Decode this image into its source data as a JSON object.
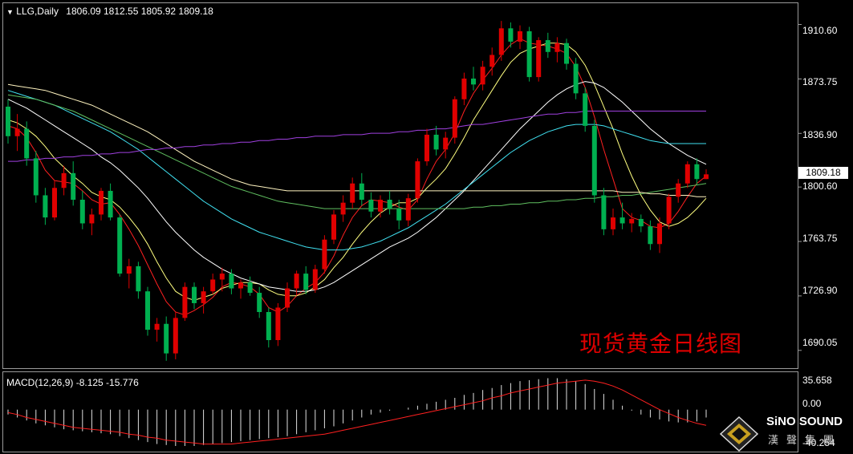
{
  "header": {
    "symbol": "LLG,Daily",
    "ohlc": "1806.09 1812.55 1805.92 1809.18"
  },
  "price_axis": {
    "labels": [
      "1910.60",
      "1873.75",
      "1836.90",
      "1800.60",
      "1763.75",
      "1726.90",
      "1690.05"
    ],
    "current_price": "1809.18"
  },
  "macd_panel": {
    "label": "MACD(12,26,9) -8.125 -15.776",
    "axis_labels": [
      "35.658",
      "0.00",
      "-40.254"
    ]
  },
  "watermark": "现货黄金日线图",
  "logo": {
    "text_en": "SiNO SOUND",
    "text_cn": "漢聲集團"
  },
  "colors": {
    "background": "#000000",
    "up_candle": "#e00000",
    "down_candle": "#00b050",
    "ma_red": "#ff2020",
    "ma_yellow": "#ffff80",
    "ma_white": "#ffffff",
    "ma_cyan": "#40e0f0",
    "ma_green": "#60c060",
    "ma_cream": "#fff4c0",
    "ma_purple": "#a040e0"
  },
  "chart_data": {
    "type": "candlestick",
    "title": "现货黄金日线图",
    "symbol": "LLG",
    "timeframe": "Daily",
    "ylim": [
      1678,
      1925
    ],
    "candles": [
      [
        1855,
        1860,
        1830,
        1835
      ],
      [
        1835,
        1850,
        1825,
        1840
      ],
      [
        1840,
        1845,
        1815,
        1820
      ],
      [
        1820,
        1825,
        1790,
        1795
      ],
      [
        1795,
        1800,
        1775,
        1780
      ],
      [
        1780,
        1805,
        1778,
        1800
      ],
      [
        1800,
        1815,
        1795,
        1810
      ],
      [
        1810,
        1818,
        1788,
        1792
      ],
      [
        1792,
        1798,
        1772,
        1776
      ],
      [
        1776,
        1786,
        1768,
        1782
      ],
      [
        1782,
        1800,
        1778,
        1798
      ],
      [
        1798,
        1803,
        1778,
        1780
      ],
      [
        1780,
        1782,
        1740,
        1742
      ],
      [
        1742,
        1752,
        1732,
        1747
      ],
      [
        1747,
        1750,
        1725,
        1730
      ],
      [
        1730,
        1733,
        1700,
        1704
      ],
      [
        1704,
        1712,
        1696,
        1708
      ],
      [
        1708,
        1713,
        1683,
        1688
      ],
      [
        1688,
        1716,
        1684,
        1712
      ],
      [
        1712,
        1736,
        1710,
        1733
      ],
      [
        1733,
        1736,
        1718,
        1722
      ],
      [
        1722,
        1733,
        1715,
        1730
      ],
      [
        1730,
        1742,
        1728,
        1738
      ],
      [
        1738,
        1746,
        1730,
        1742
      ],
      [
        1742,
        1745,
        1728,
        1732
      ],
      [
        1732,
        1738,
        1725,
        1736
      ],
      [
        1736,
        1740,
        1727,
        1729
      ],
      [
        1729,
        1733,
        1712,
        1716
      ],
      [
        1716,
        1719,
        1692,
        1697
      ],
      [
        1697,
        1722,
        1693,
        1719
      ],
      [
        1719,
        1736,
        1716,
        1732
      ],
      [
        1732,
        1744,
        1727,
        1742
      ],
      [
        1742,
        1747,
        1728,
        1731
      ],
      [
        1731,
        1748,
        1729,
        1745
      ],
      [
        1745,
        1768,
        1742,
        1765
      ],
      [
        1765,
        1785,
        1762,
        1782
      ],
      [
        1782,
        1795,
        1777,
        1790
      ],
      [
        1790,
        1807,
        1786,
        1803
      ],
      [
        1803,
        1810,
        1788,
        1792
      ],
      [
        1792,
        1797,
        1780,
        1784
      ],
      [
        1784,
        1795,
        1780,
        1792
      ],
      [
        1792,
        1798,
        1782,
        1786
      ],
      [
        1786,
        1792,
        1772,
        1778
      ],
      [
        1778,
        1796,
        1774,
        1793
      ],
      [
        1793,
        1820,
        1790,
        1818
      ],
      [
        1818,
        1840,
        1815,
        1836
      ],
      [
        1836,
        1842,
        1822,
        1826
      ],
      [
        1826,
        1838,
        1820,
        1834
      ],
      [
        1834,
        1862,
        1830,
        1860
      ],
      [
        1860,
        1878,
        1856,
        1874
      ],
      [
        1874,
        1882,
        1866,
        1870
      ],
      [
        1870,
        1886,
        1866,
        1882
      ],
      [
        1882,
        1895,
        1876,
        1890
      ],
      [
        1890,
        1913,
        1886,
        1908
      ],
      [
        1908,
        1912,
        1895,
        1899
      ],
      [
        1899,
        1910,
        1894,
        1906
      ],
      [
        1906,
        1909,
        1872,
        1875
      ],
      [
        1875,
        1902,
        1872,
        1900
      ],
      [
        1900,
        1905,
        1888,
        1892
      ],
      [
        1892,
        1902,
        1885,
        1898
      ],
      [
        1898,
        1901,
        1880,
        1884
      ],
      [
        1884,
        1888,
        1860,
        1864
      ],
      [
        1864,
        1868,
        1838,
        1842
      ],
      [
        1842,
        1846,
        1790,
        1795
      ],
      [
        1795,
        1800,
        1768,
        1772
      ],
      [
        1772,
        1786,
        1768,
        1780
      ],
      [
        1780,
        1790,
        1772,
        1776
      ],
      [
        1776,
        1783,
        1770,
        1779
      ],
      [
        1779,
        1782,
        1770,
        1774
      ],
      [
        1774,
        1778,
        1758,
        1762
      ],
      [
        1762,
        1780,
        1756,
        1776
      ],
      [
        1776,
        1796,
        1772,
        1794
      ],
      [
        1794,
        1806,
        1790,
        1803
      ],
      [
        1803,
        1818,
        1800,
        1816
      ],
      [
        1816,
        1820,
        1802,
        1806
      ],
      [
        1806,
        1812.55,
        1805.92,
        1809.18
      ]
    ],
    "moving_averages": [
      {
        "color": "#ff2020",
        "values": [
          1842,
          1840,
          1834,
          1824,
          1812,
          1805,
          1804,
          1803,
          1798,
          1792,
          1789,
          1790,
          1782,
          1772,
          1761,
          1748,
          1735,
          1723,
          1716,
          1714,
          1717,
          1721,
          1726,
          1733,
          1736,
          1735,
          1733,
          1728,
          1719,
          1716,
          1720,
          1727,
          1732,
          1736,
          1743,
          1754,
          1768,
          1780,
          1788,
          1792,
          1791,
          1790,
          1787,
          1785,
          1792,
          1806,
          1818,
          1826,
          1837,
          1852,
          1864,
          1873,
          1881,
          1890,
          1897,
          1901,
          1898,
          1897,
          1896,
          1894,
          1891,
          1882,
          1868,
          1848,
          1826,
          1806,
          1786,
          1780,
          1778,
          1774,
          1773,
          1776,
          1784,
          1794,
          1803,
          1808
        ]
      },
      {
        "color": "#ffff80",
        "values": [
          1846,
          1844,
          1840,
          1835,
          1828,
          1820,
          1814,
          1808,
          1803,
          1797,
          1794,
          1792,
          1787,
          1780,
          1772,
          1762,
          1750,
          1739,
          1730,
          1726,
          1724,
          1726,
          1728,
          1732,
          1734,
          1736,
          1736,
          1735,
          1731,
          1728,
          1727,
          1727,
          1729,
          1733,
          1738,
          1746,
          1753,
          1762,
          1770,
          1777,
          1783,
          1787,
          1790,
          1790,
          1793,
          1800,
          1806,
          1813,
          1823,
          1834,
          1846,
          1856,
          1866,
          1876,
          1885,
          1891,
          1894,
          1896,
          1898,
          1898,
          1897,
          1892,
          1883,
          1870,
          1855,
          1840,
          1823,
          1808,
          1795,
          1785,
          1777,
          1774,
          1776,
          1780,
          1786,
          1793
        ]
      },
      {
        "color": "#ffffff",
        "values": [
          1860,
          1857,
          1854,
          1850,
          1846,
          1842,
          1838,
          1834,
          1830,
          1826,
          1821,
          1817,
          1812,
          1806,
          1800,
          1793,
          1785,
          1777,
          1770,
          1764,
          1758,
          1753,
          1749,
          1745,
          1742,
          1739,
          1737,
          1735,
          1733,
          1732,
          1731,
          1730,
          1730,
          1731,
          1733,
          1736,
          1740,
          1744,
          1748,
          1752,
          1756,
          1760,
          1763,
          1766,
          1770,
          1775,
          1780,
          1786,
          1792,
          1798,
          1805,
          1812,
          1819,
          1826,
          1833,
          1840,
          1846,
          1852,
          1858,
          1863,
          1867,
          1870,
          1872,
          1871,
          1868,
          1863,
          1858,
          1852,
          1846,
          1840,
          1835,
          1830,
          1826,
          1822,
          1819,
          1816
        ]
      },
      {
        "color": "#40e0f0",
        "values": [
          1866,
          1864,
          1862,
          1860,
          1858,
          1856,
          1853,
          1850,
          1847,
          1844,
          1841,
          1838,
          1834,
          1830,
          1826,
          1821,
          1816,
          1811,
          1806,
          1801,
          1796,
          1791,
          1787,
          1783,
          1779,
          1776,
          1773,
          1770,
          1768,
          1766,
          1764,
          1762,
          1760,
          1759,
          1758,
          1758,
          1758,
          1759,
          1760,
          1762,
          1764,
          1767,
          1770,
          1773,
          1777,
          1781,
          1785,
          1789,
          1794,
          1799,
          1804,
          1809,
          1814,
          1819,
          1824,
          1828,
          1832,
          1835,
          1838,
          1840,
          1842,
          1843,
          1843,
          1843,
          1842,
          1840,
          1838,
          1836,
          1834,
          1832,
          1831,
          1830,
          1830,
          1830,
          1830,
          1830
        ]
      },
      {
        "color": "#60c060",
        "values": [
          1863,
          1862,
          1861,
          1860,
          1858,
          1856,
          1854,
          1852,
          1849,
          1846,
          1843,
          1840,
          1837,
          1834,
          1831,
          1828,
          1825,
          1822,
          1819,
          1816,
          1813,
          1810,
          1807,
          1804,
          1801,
          1799,
          1797,
          1795,
          1793,
          1791,
          1790,
          1789,
          1788,
          1787,
          1786,
          1786,
          1786,
          1786,
          1786,
          1786,
          1786,
          1786,
          1786,
          1786,
          1786,
          1786,
          1786,
          1786,
          1786,
          1786,
          1787,
          1787,
          1788,
          1788,
          1789,
          1789,
          1790,
          1790,
          1791,
          1791,
          1792,
          1792,
          1793,
          1793,
          1794,
          1794,
          1795,
          1795,
          1796,
          1797,
          1798,
          1799,
          1800,
          1801,
          1802,
          1803
        ]
      },
      {
        "color": "#fff4c0",
        "values": [
          1870,
          1869,
          1868,
          1867,
          1866,
          1864,
          1862,
          1860,
          1858,
          1856,
          1853,
          1850,
          1847,
          1844,
          1841,
          1838,
          1834,
          1830,
          1826,
          1822,
          1818,
          1815,
          1812,
          1809,
          1806,
          1804,
          1802,
          1801,
          1800,
          1799,
          1798,
          1798,
          1798,
          1798,
          1798,
          1798,
          1798,
          1798,
          1798,
          1798,
          1798,
          1798,
          1798,
          1798,
          1798,
          1798,
          1798,
          1798,
          1798,
          1798,
          1798,
          1798,
          1798,
          1798,
          1798,
          1798,
          1798,
          1798,
          1798,
          1798,
          1798,
          1798,
          1798,
          1798,
          1798,
          1798,
          1797,
          1797,
          1797,
          1796,
          1796,
          1795,
          1795,
          1795,
          1794,
          1794
        ]
      },
      {
        "color": "#a040e0",
        "values": [
          1818,
          1818,
          1819,
          1819,
          1820,
          1820,
          1821,
          1821,
          1822,
          1822,
          1823,
          1823,
          1824,
          1824,
          1825,
          1826,
          1826,
          1827,
          1827,
          1828,
          1828,
          1829,
          1829,
          1830,
          1830,
          1831,
          1831,
          1832,
          1832,
          1833,
          1833,
          1834,
          1834,
          1835,
          1835,
          1835,
          1836,
          1836,
          1836,
          1837,
          1837,
          1837,
          1838,
          1838,
          1839,
          1839,
          1840,
          1840,
          1841,
          1842,
          1843,
          1843,
          1844,
          1845,
          1846,
          1847,
          1848,
          1849,
          1850,
          1850,
          1851,
          1851,
          1852,
          1852,
          1852,
          1852,
          1852,
          1852,
          1852,
          1852,
          1852,
          1852,
          1852,
          1852,
          1852,
          1852
        ]
      }
    ],
    "macd": {
      "ylim": [
        -40.254,
        35.658
      ],
      "histogram": [
        -5,
        -8,
        -11,
        -14,
        -16,
        -18,
        -20,
        -21,
        -22,
        -23,
        -24,
        -25,
        -27,
        -29,
        -31,
        -33,
        -35,
        -36,
        -37,
        -37,
        -37,
        -36,
        -35,
        -34,
        -33,
        -32,
        -31,
        -30,
        -29,
        -28,
        -27,
        -25,
        -23,
        -21,
        -19,
        -17,
        -14,
        -11,
        -8,
        -5,
        -3,
        -1,
        0,
        2,
        4,
        6,
        8,
        10,
        12,
        15,
        17,
        20,
        22,
        25,
        27,
        29,
        30,
        31,
        32,
        32,
        31,
        29,
        26,
        21,
        16,
        10,
        4,
        -1,
        -5,
        -8,
        -10,
        -12,
        -13,
        -13,
        -12,
        -8
      ],
      "signal": [
        -3,
        -5,
        -8,
        -10,
        -12,
        -14,
        -16,
        -18,
        -19,
        -20,
        -21,
        -22,
        -23,
        -25,
        -26,
        -28,
        -29,
        -31,
        -32,
        -33,
        -34,
        -35,
        -35,
        -35,
        -35,
        -34,
        -33,
        -32,
        -31,
        -30,
        -29,
        -28,
        -27,
        -26,
        -25,
        -23,
        -21,
        -19,
        -17,
        -15,
        -13,
        -11,
        -9,
        -7,
        -5,
        -3,
        -1,
        1,
        3,
        5,
        7,
        9,
        12,
        14,
        17,
        19,
        21,
        23,
        25,
        27,
        28,
        29,
        30,
        29,
        27,
        24,
        20,
        15,
        10,
        5,
        0,
        -4,
        -8,
        -11,
        -14,
        -16
      ]
    }
  }
}
